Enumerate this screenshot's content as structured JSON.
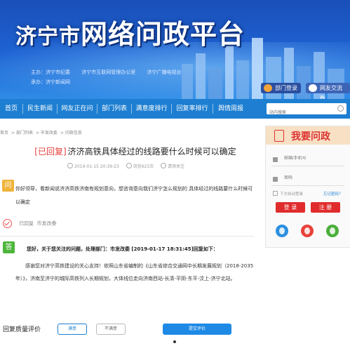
{
  "banner": {
    "title_prefix": "济宁市",
    "title_main": "网络问政平台",
    "hosts": [
      "主办：济宁市纪委",
      "济宁市互联网管理办公室",
      "济宁广播电视台"
    ],
    "undertaker": "承办：济宁新闻网",
    "dept_login_label": "部门登录",
    "net_exchange_label": "网友交流群"
  },
  "nav": {
    "items": [
      "首页",
      "民生新闻",
      "网友正在问",
      "部门列表",
      "满意度排行",
      "回复率排行",
      "舆情周报"
    ],
    "search_placeholder": "站内搜索"
  },
  "breadcrumb": [
    "首页",
    "部门列表",
    "市发改委",
    "问政信息"
  ],
  "post": {
    "status": "[已回复]",
    "title": "济济高铁具体经过的线路要什么时候可以确定",
    "datetime": "2019-01-15 20:39:23",
    "views": "浏览623次",
    "followers": "请添关注"
  },
  "question": {
    "icon": "问",
    "text": "你好领导，看新闻说济济高铁济南有规划意向，想咨询意向我们济宁怎么规划的 具体经过的线路要什么时候可以确定"
  },
  "status_row": {
    "label": "已回复",
    "dept": "市发改委"
  },
  "answer": {
    "icon": "答",
    "head": "您好，关于您关注的问题，处理部门：市发改委 [2019-01-17 18:31:45]回复如下：",
    "body": "感谢您对济宁高铁建设的关心支持！依照山东省编制的《山东省综合交通网中长期发展规划（2018-2035年）》，济南至济宁的城际高铁列入长期规划，大体线位走向济南西站-长清-平阴-东平-汶上-济宁北站。"
  },
  "rating": {
    "label": "回复质量评价",
    "good": "满意",
    "bad": "不满意",
    "submit": "提交评价"
  },
  "sidebar": {
    "title": "我要问政",
    "email_placeholder": "邮箱/手机号",
    "password_placeholder": "密码",
    "remember": "下次自动登录",
    "forgot": "忘记密码？",
    "login": "登 录",
    "register": "注 册",
    "socials": [
      "qq-icon",
      "weibo-icon",
      "wechat-icon"
    ]
  },
  "colors": {
    "nav_blue": "#1e7fd2",
    "accent_red": "#e02c2c",
    "question_orange": "#f0b33a",
    "answer_green": "#4db53a"
  }
}
